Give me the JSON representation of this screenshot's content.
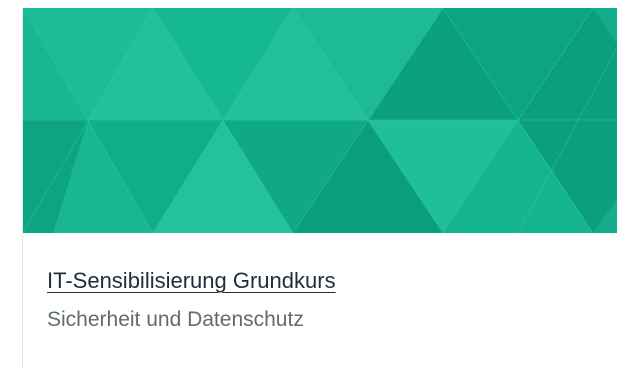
{
  "card": {
    "title": "IT-Sensibilisierung Grundkurs",
    "subtitle": "Sicherheit und Datenschutz",
    "banner_colors": {
      "base": "#14b591",
      "light": "#23c29d",
      "dark": "#0a9d7c",
      "lines": "#3cc8a6"
    }
  }
}
